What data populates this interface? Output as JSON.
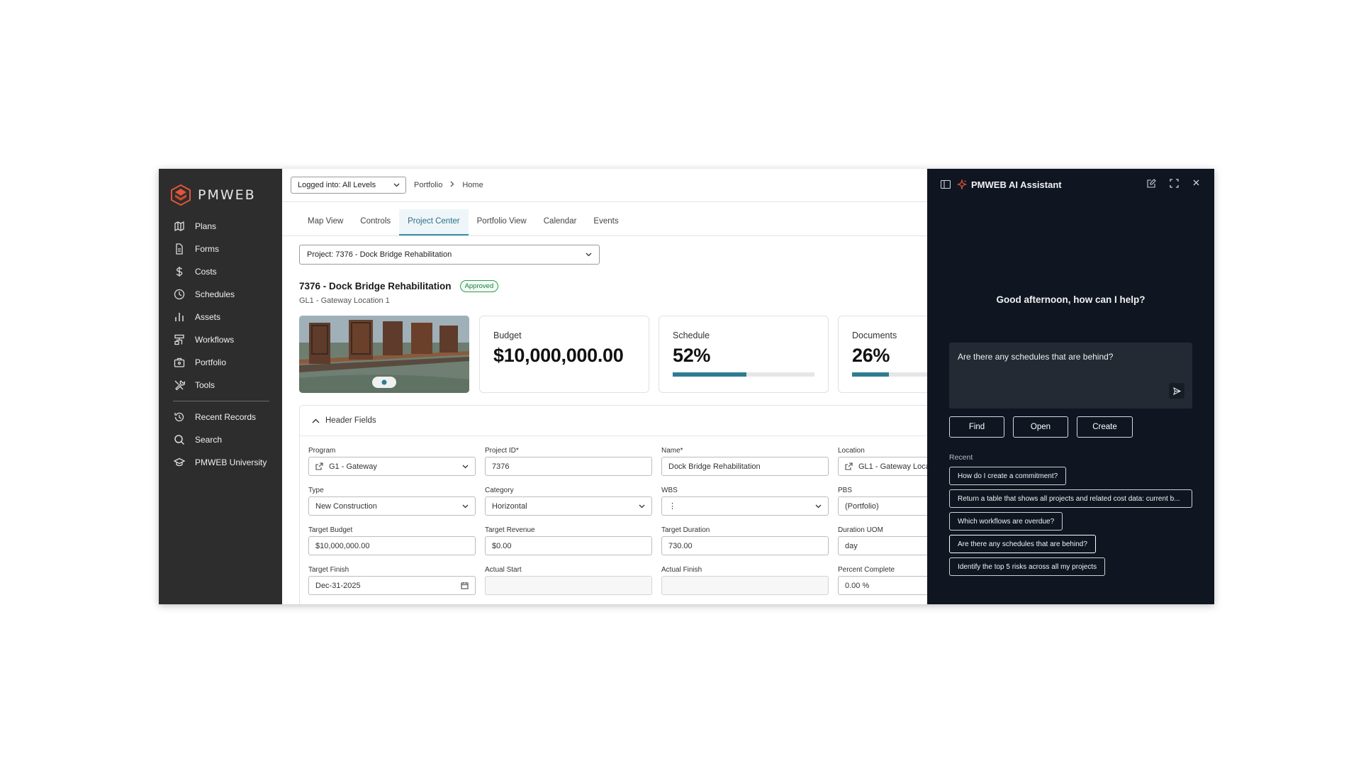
{
  "brand": {
    "name": "PMWEB",
    "accent": "#e0553a"
  },
  "sidebar": {
    "items": [
      {
        "label": "Plans",
        "icon": "map-icon"
      },
      {
        "label": "Forms",
        "icon": "document-icon"
      },
      {
        "label": "Costs",
        "icon": "dollar-icon"
      },
      {
        "label": "Schedules",
        "icon": "clock-icon"
      },
      {
        "label": "Assets",
        "icon": "bar-chart-icon"
      },
      {
        "label": "Workflows",
        "icon": "workflow-icon"
      },
      {
        "label": "Portfolio",
        "icon": "briefcase-icon"
      },
      {
        "label": "Tools",
        "icon": "tools-icon"
      }
    ],
    "secondary": [
      {
        "label": "Recent Records",
        "icon": "history-icon"
      },
      {
        "label": "Search",
        "icon": "search-icon"
      },
      {
        "label": "PMWEB University",
        "icon": "graduation-icon"
      }
    ]
  },
  "topbar": {
    "login_label": "Logged into: All Levels",
    "breadcrumb": [
      "Portfolio",
      "Home"
    ]
  },
  "tabs": [
    "Map View",
    "Controls",
    "Project Center",
    "Portfolio View",
    "Calendar",
    "Events"
  ],
  "active_tab": "Project Center",
  "project": {
    "selector": "Project: 7376 - Dock Bridge Rehabilitation",
    "title": "7376 - Dock Bridge Rehabilitation",
    "status": "Approved",
    "subtitle": "GL1 - Gateway Location 1"
  },
  "kpis": {
    "budget": {
      "label": "Budget",
      "value": "$10,000,000.00"
    },
    "schedule": {
      "label": "Schedule",
      "value": "52%",
      "progress": 0.52
    },
    "documents": {
      "label": "Documents",
      "value": "26%",
      "progress": 0.26
    }
  },
  "header_fields": {
    "title": "Header Fields",
    "program": {
      "label": "Program",
      "value": "G1 - Gateway"
    },
    "project_id": {
      "label": "Project ID*",
      "value": "7376"
    },
    "name": {
      "label": "Name*",
      "value": "Dock Bridge Rehabilitation"
    },
    "location": {
      "label": "Location",
      "value": "GL1 - Gateway Loca"
    },
    "type": {
      "label": "Type",
      "value": "New Construction"
    },
    "category": {
      "label": "Category",
      "value": "Horizontal"
    },
    "wbs": {
      "label": "WBS",
      "value": "⋮"
    },
    "pbs": {
      "label": "PBS",
      "value": "(Portfolio)"
    },
    "target_budget": {
      "label": "Target Budget",
      "value": "$10,000,000.00"
    },
    "target_revenue": {
      "label": "Target Revenue",
      "value": "$0.00"
    },
    "target_duration": {
      "label": "Target Duration",
      "value": "730.00"
    },
    "duration_uom": {
      "label": "Duration UOM",
      "value": "day"
    },
    "target_finish": {
      "label": "Target Finish",
      "value": "Dec-31-2025"
    },
    "actual_start": {
      "label": "Actual Start",
      "value": ""
    },
    "actual_finish": {
      "label": "Actual Finish",
      "value": ""
    },
    "percent_complete": {
      "label": "Percent Complete",
      "value": "0.00 %"
    }
  },
  "ai": {
    "title": "PMWEB AI Assistant",
    "greeting": "Good afternoon, how can I help?",
    "prompt": "Are there any schedules that are behind?",
    "actions": [
      "Find",
      "Open",
      "Create"
    ],
    "recent_label": "Recent",
    "recent": [
      "How do I create a commitment?",
      "Return a table that shows all projects and related cost data: current b...",
      "Which workflows are overdue?",
      "Are there any schedules that are behind?",
      "Identify the top 5 risks across all my projects"
    ]
  }
}
